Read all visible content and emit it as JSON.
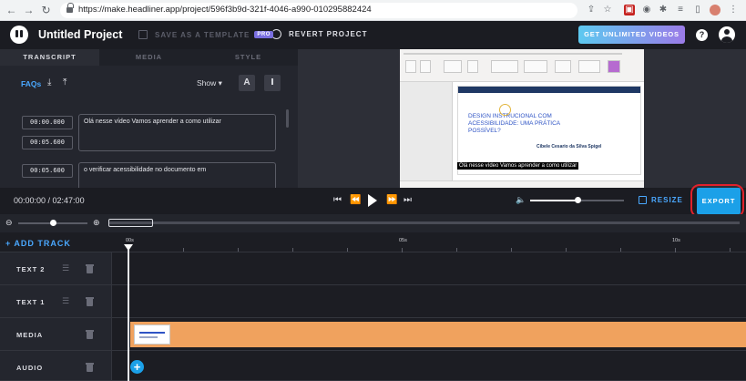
{
  "browser": {
    "url": "https://make.headliner.app/project/596f3b9d-321f-4046-a990-010295882424"
  },
  "header": {
    "project_title": "Untitled Project",
    "save_template_label": "SAVE AS A TEMPLATE",
    "pro_badge": "PRO",
    "revert_label": "REVERT PROJECT",
    "unlimited_label": "GET UNLIMITED VIDEOS",
    "help_label": "?"
  },
  "left_panel": {
    "tabs": [
      "TRANSCRIPT",
      "MEDIA",
      "STYLE"
    ],
    "active_tab": "TRANSCRIPT",
    "faqs_label": "FAQs",
    "show_dropdown": "Show ▾",
    "font_button_label": "A",
    "style_button_label": "Ⅰ",
    "transcript": [
      {
        "start": "00:00.000",
        "end": "00:05.600",
        "text": "Olá nesse vídeo Vamos aprender a como utilizar"
      },
      {
        "start": "00:05.600",
        "end": "",
        "text": "o verificar acessibilidade no documento em"
      }
    ]
  },
  "preview": {
    "slide_title": "DESIGN INSTRUCIONAL COM ACESSIBILIDADE: UMA PRÁTICA POSSÍVEL?",
    "slide_author": "Cibele Cesario da Silva Spigel",
    "caption": "Olá nesse vídeo Vamos aprender a como utilizar"
  },
  "player": {
    "timecode": "00:00:00 / 02:47:00",
    "volume_fraction": 0.5,
    "resize_label": "RESIZE",
    "export_label": "EXPORT"
  },
  "timeline": {
    "add_track_label": "+ ADD TRACK",
    "ruler_labels": [
      "00s",
      "05s",
      "10s"
    ],
    "tracks": [
      {
        "name": "TEXT 2"
      },
      {
        "name": "TEXT 1"
      },
      {
        "name": "MEDIA"
      },
      {
        "name": "AUDIO"
      }
    ]
  },
  "colors": {
    "accent": "#1ba0e8",
    "link": "#4aa8ff",
    "media_clip": "#f0a25e",
    "export_highlight": "#e0212b"
  }
}
